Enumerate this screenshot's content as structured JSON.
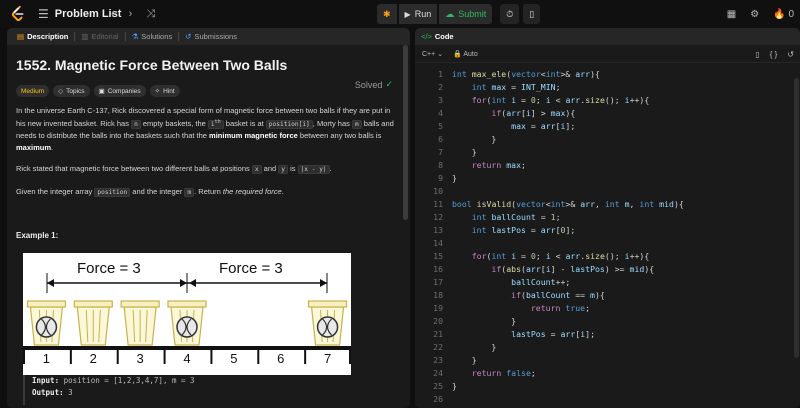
{
  "topbar": {
    "problem_list_label": "Problem List",
    "run_label": "Run",
    "submit_label": "Submit",
    "streak_count": "0"
  },
  "left_tabs": {
    "description": "Description",
    "editorial": "Editorial",
    "solutions": "Solutions",
    "submissions": "Submissions"
  },
  "problem": {
    "title": "1552. Magnetic Force Between Two Balls",
    "solved_label": "Solved",
    "chips": [
      "Medium",
      "Topics",
      "Companies",
      "Hint"
    ],
    "p1": {
      "a": "In the universe Earth C-137, Rick discovered a special form of magnetic force between two balls if they are put in his new invented basket. Rick has ",
      "n": "n",
      "b": " empty baskets, the ",
      "ith": "i",
      "th_sup": "th",
      "c": " basket is at ",
      "pos": "position[i]",
      "d": ", Morty has ",
      "m": "m",
      "e": " balls and needs to distribute the balls into the baskets such that the ",
      "bold1": "minimum magnetic force",
      "f": " between any two balls is ",
      "bold2": "maximum",
      "g": "."
    },
    "p2": {
      "a": "Rick stated that magnetic force between two different balls at positions ",
      "x": "x",
      "b": " and ",
      "y": "y",
      "c": " is ",
      "expr": "|x - y|",
      "d": "."
    },
    "p3": {
      "a": "Given the integer array ",
      "position": "position",
      "b": " and the integer ",
      "m": "m",
      "c": ". Return ",
      "em": "the required force",
      "d": "."
    },
    "example_title": "Example 1:",
    "figure": {
      "force_left": "Force = 3",
      "force_right": "Force = 3",
      "positions": [
        "1",
        "2",
        "3",
        "4",
        "5",
        "6",
        "7"
      ]
    },
    "input_label": "Input:",
    "input_value": " position = [1,2,3,4,7], m = 3",
    "output_label": "Output:",
    "output_value": " 3"
  },
  "code_panel": {
    "tab_label": "Code",
    "language": "C++",
    "auto_label": "Auto"
  },
  "code_lines": [
    {
      "n": "1",
      "t": "int max_ele(vector<int>& arr){"
    },
    {
      "n": "2",
      "t": "    int max = INT_MIN;"
    },
    {
      "n": "3",
      "t": "    for(int i = 0; i < arr.size(); i++){"
    },
    {
      "n": "4",
      "t": "        if(arr[i] > max){"
    },
    {
      "n": "5",
      "t": "            max = arr[i];"
    },
    {
      "n": "6",
      "t": "        }"
    },
    {
      "n": "7",
      "t": "    }"
    },
    {
      "n": "8",
      "t": "    return max;"
    },
    {
      "n": "9",
      "t": "}"
    },
    {
      "n": "10",
      "t": ""
    },
    {
      "n": "11",
      "t": "bool isValid(vector<int>& arr, int m, int mid){"
    },
    {
      "n": "12",
      "t": "    int ballCount = 1;"
    },
    {
      "n": "13",
      "t": "    int lastPos = arr[0];"
    },
    {
      "n": "14",
      "t": ""
    },
    {
      "n": "15",
      "t": "    for(int i = 0; i < arr.size(); i++){"
    },
    {
      "n": "16",
      "t": "        if(abs(arr[i] - lastPos) >= mid){"
    },
    {
      "n": "17",
      "t": "            ballCount++;"
    },
    {
      "n": "18",
      "t": "            if(ballCount == m){"
    },
    {
      "n": "19",
      "t": "                return true;"
    },
    {
      "n": "20",
      "t": "            }"
    },
    {
      "n": "21",
      "t": "            lastPos = arr[i];"
    },
    {
      "n": "22",
      "t": "        }"
    },
    {
      "n": "23",
      "t": "    }"
    },
    {
      "n": "24",
      "t": "    return false;"
    },
    {
      "n": "25",
      "t": "}"
    },
    {
      "n": "26",
      "t": ""
    }
  ],
  "colors": {
    "accent_green": "#2cbb5d",
    "medium_yellow": "#ffc01e",
    "keyword_blue": "#569cd6"
  }
}
